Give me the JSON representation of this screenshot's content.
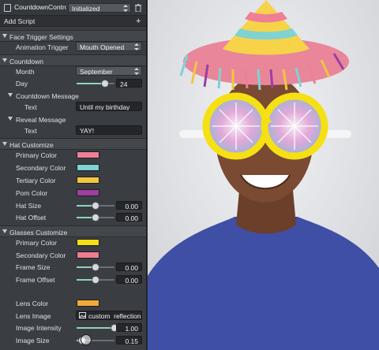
{
  "header": {
    "script_name": "CountdownContro",
    "state": "Initialized",
    "add_script": "Add Script"
  },
  "face_trigger": {
    "section": "Face Trigger Settings",
    "animation_trigger_label": "Animation Trigger",
    "animation_trigger_value": "Mouth Opened"
  },
  "countdown": {
    "section": "Countdown",
    "month_label": "Month",
    "month_value": "September",
    "day_label": "Day",
    "day_value": "24",
    "day_slider": 0.75,
    "countdown_message_section": "Countdown Message",
    "countdown_text_label": "Text",
    "countdown_text_value": "Until my birthday",
    "reveal_message_section": "Reveal Message",
    "reveal_text_label": "Text",
    "reveal_text_value": "YAY!"
  },
  "hat": {
    "section": "Hat Customize",
    "primary_label": "Primary Color",
    "primary_color": "#ee7f95",
    "secondary_label": "Secondary Color",
    "secondary_color": "#7fd3d1",
    "tertiary_label": "Tertiary Color",
    "tertiary_color": "#f1c640",
    "pom_label": "Pom Color",
    "pom_color": "#9d3fa1",
    "size_label": "Hat Size",
    "size_value": "0.00",
    "size_slider": 0.5,
    "offset_label": "Hat Offset",
    "offset_value": "0.00",
    "offset_slider": 0.5
  },
  "glasses": {
    "section": "Glasses Customize",
    "primary_label": "Primary Color",
    "primary_color": "#f5e013",
    "secondary_label": "Secondary Color",
    "secondary_color": "#ef7d92",
    "frame_size_label": "Frame Size",
    "frame_size_value": "0.00",
    "frame_size_slider": 0.5,
    "frame_offset_label": "Frame Offset",
    "frame_offset_value": "0.00",
    "frame_offset_slider": 0.5,
    "lens_color_label": "Lens Color",
    "lens_color": "#f3a93a",
    "lens_image_label": "Lens Image",
    "lens_image_value": "custom_reflection",
    "image_intensity_label": "Image Intensity",
    "image_intensity_value": "1.00",
    "image_intensity_slider": 1.0,
    "image_size_label": "Image Size",
    "image_size_value": "0.15",
    "image_size_slider": 0.15
  },
  "icons": {
    "component": "script-icon",
    "delete": "trash-icon",
    "add": "plus-icon",
    "image": "image-icon"
  },
  "colors": {
    "panel": "#3a3d42",
    "accent": "#8fd3bd"
  }
}
